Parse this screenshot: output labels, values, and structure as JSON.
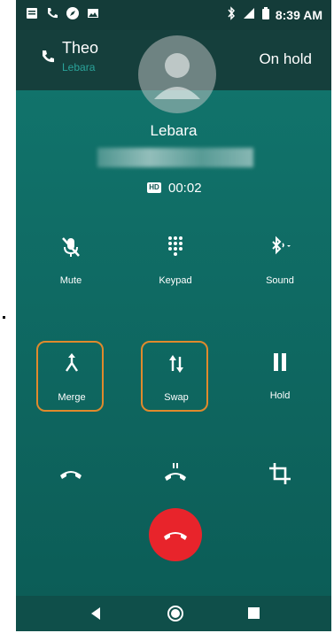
{
  "status_bar": {
    "time": "8:39 AM",
    "icons": [
      "notification-icon",
      "phone-icon",
      "compass-icon",
      "image-icon",
      "bluetooth-icon",
      "signal-icon",
      "battery-icon"
    ]
  },
  "held_call": {
    "name": "Theo",
    "carrier": "Lebara",
    "status": "On hold"
  },
  "active_call": {
    "carrier": "Lebara",
    "hd_badge": "HD",
    "duration": "00:02"
  },
  "controls": {
    "row1": [
      {
        "label": "Mute",
        "icon": "mute-mic-icon"
      },
      {
        "label": "Keypad",
        "icon": "keypad-icon"
      },
      {
        "label": "Sound",
        "icon": "bluetooth-audio-icon"
      }
    ],
    "row2": [
      {
        "label": "Merge",
        "icon": "merge-icon"
      },
      {
        "label": "Swap",
        "icon": "swap-icon"
      },
      {
        "label": "Hold",
        "icon": "pause-icon"
      }
    ],
    "row3": [
      {
        "icon": "hangup-icon"
      },
      {
        "icon": "add-call-icon"
      },
      {
        "icon": "crop-icon"
      }
    ]
  },
  "colors": {
    "background": "#0f6a63",
    "highlight": "#e08a2c",
    "end_call": "#e8242b"
  }
}
